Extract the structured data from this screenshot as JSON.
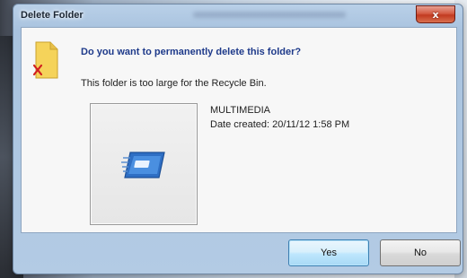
{
  "window": {
    "title": "Delete Folder",
    "close_glyph": "x"
  },
  "dialog": {
    "question": "Do you want to permanently delete this folder?",
    "message": "This folder is too large for the Recycle Bin.",
    "item": {
      "name": "MULTIMEDIA",
      "date_created": "Date created: 20/11/12 1:58 PM"
    }
  },
  "buttons": {
    "yes_label": "Yes",
    "no_label": "No"
  },
  "icons": {
    "folder": "folder-delete-icon",
    "media": "multimedia-folder-icon"
  },
  "colors": {
    "question_text": "#1e3a8a",
    "close_button": "#c13a20",
    "default_button_border": "#3c7fb1"
  }
}
